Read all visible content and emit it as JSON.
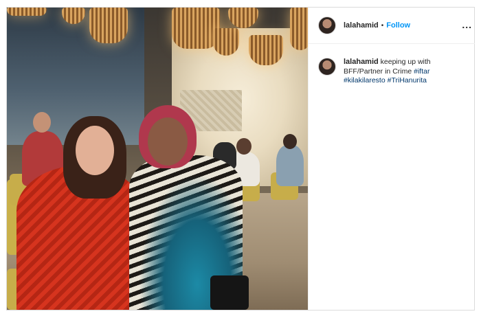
{
  "post": {
    "username": "lalahamid",
    "separator": "•",
    "follow_label": "Follow",
    "more_label": "...",
    "caption": {
      "username": "lalahamid",
      "text": " keeping up with BFF/Partner in Crime ",
      "hashtags": [
        "#iftar",
        "#kilakilaresto",
        "#TriHanurita"
      ]
    }
  },
  "icons": {
    "avatar": "profile-avatar",
    "more": "more-options-icon"
  }
}
